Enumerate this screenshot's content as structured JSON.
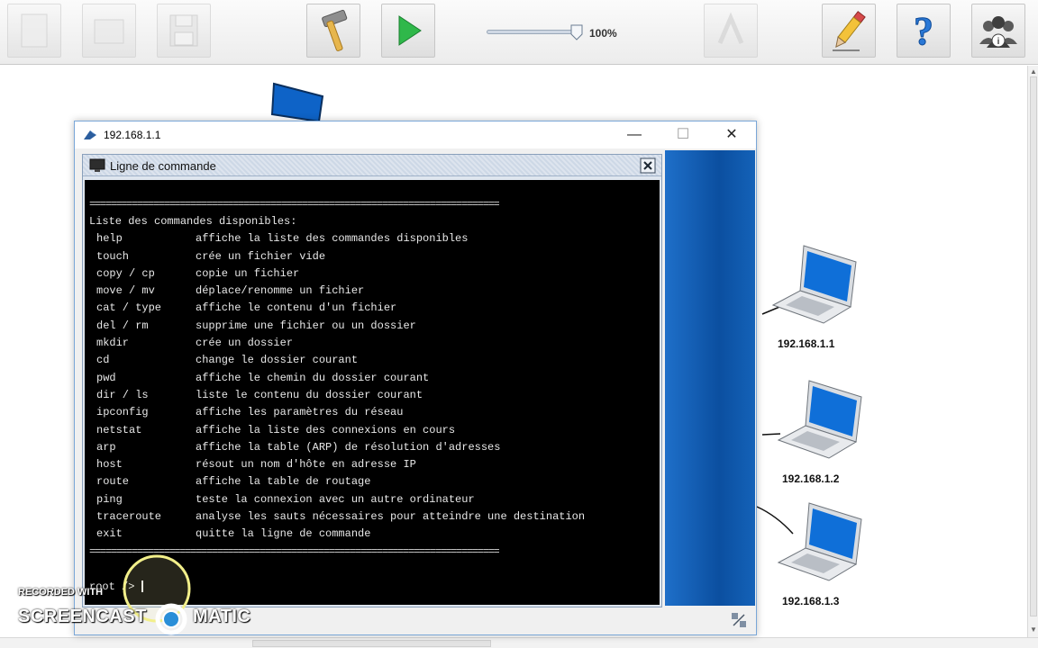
{
  "toolbar": {
    "buttons": [
      {
        "name": "new-file",
        "enabled": false
      },
      {
        "name": "open-file",
        "enabled": false
      },
      {
        "name": "save-file",
        "enabled": false
      },
      {
        "name": "hammer-icon",
        "enabled": true
      },
      {
        "name": "play-icon",
        "enabled": true
      },
      {
        "name": "undo-graph",
        "enabled": false
      },
      {
        "name": "pencil-icon",
        "enabled": true
      },
      {
        "name": "help-icon",
        "enabled": true
      },
      {
        "name": "users-info-icon",
        "enabled": true
      }
    ],
    "zoom": {
      "value": 100,
      "label": "100%"
    }
  },
  "network": {
    "machines": [
      {
        "label": "192.168.1.1"
      },
      {
        "label": "192.168.1.2"
      },
      {
        "label": "192.168.1.3"
      }
    ]
  },
  "window": {
    "title": "192.168.1.1",
    "controls": {
      "minimize": "—",
      "maximize": "☐",
      "close": "✕"
    },
    "frame": {
      "title": "Ligne de commande",
      "terminal": {
        "separator": "=============================================================================",
        "heading": "Liste des commandes disponibles:",
        "commands": [
          {
            "cmd": "help",
            "desc": "affiche la liste des commandes disponibles"
          },
          {
            "cmd": "touch",
            "desc": "crée un fichier vide"
          },
          {
            "cmd": "copy / cp",
            "desc": "copie un fichier"
          },
          {
            "cmd": "move / mv",
            "desc": "déplace/renomme un fichier"
          },
          {
            "cmd": "cat / type",
            "desc": "affiche le contenu d'un fichier"
          },
          {
            "cmd": "del / rm",
            "desc": "supprime une fichier ou un dossier"
          },
          {
            "cmd": "mkdir",
            "desc": "crée un dossier"
          },
          {
            "cmd": "cd",
            "desc": "change le dossier courant"
          },
          {
            "cmd": "pwd",
            "desc": "affiche le chemin du dossier courant"
          },
          {
            "cmd": "dir / ls",
            "desc": "liste le contenu du dossier courant"
          },
          {
            "cmd": "ipconfig",
            "desc": "affiche les paramètres du réseau"
          },
          {
            "cmd": "netstat",
            "desc": "affiche la liste des connexions en cours"
          },
          {
            "cmd": "arp",
            "desc": "affiche la table (ARP) de résolution d'adresses"
          },
          {
            "cmd": "host",
            "desc": "résout un nom d'hôte en adresse IP"
          },
          {
            "cmd": "route",
            "desc": "affiche la table de routage"
          },
          {
            "cmd": "ping",
            "desc": "teste la connexion avec un autre ordinateur"
          },
          {
            "cmd": "traceroute",
            "desc": "analyse les sauts nécessaires pour atteindre une destination"
          },
          {
            "cmd": "exit",
            "desc": "quitte la ligne de commande"
          }
        ],
        "prompt": "root />"
      }
    }
  },
  "watermark": {
    "top": "RECORDED WITH",
    "left": "SCREENCAST",
    "right": "MATIC"
  },
  "colors": {
    "terminal_bg": "#000000",
    "terminal_fg": "#e8e8e8",
    "window_accent": "#0b4fa0",
    "play_green": "#2fb84a"
  }
}
